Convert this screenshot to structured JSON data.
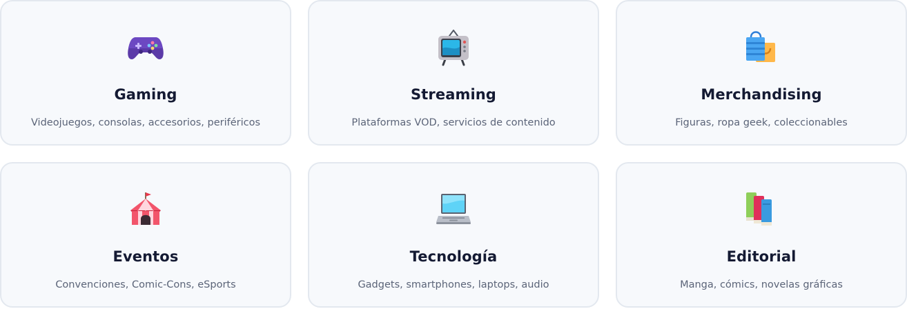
{
  "cards": [
    {
      "icon": "game-controller-icon",
      "title": "Gaming",
      "description": "Videojuegos, consolas, accesorios, periféricos"
    },
    {
      "icon": "television-icon",
      "title": "Streaming",
      "description": "Plataformas VOD, servicios de contenido"
    },
    {
      "icon": "shopping-bags-icon",
      "title": "Merchandising",
      "description": "Figuras, ropa geek, coleccionables"
    },
    {
      "icon": "circus-tent-icon",
      "title": "Eventos",
      "description": "Convenciones, Comic-Cons, eSports"
    },
    {
      "icon": "laptop-icon",
      "title": "Tecnología",
      "description": "Gadgets, smartphones, laptops, audio"
    },
    {
      "icon": "books-icon",
      "title": "Editorial",
      "description": "Manga, cómics, novelas gráficas"
    }
  ],
  "colors": {
    "card_background": "#f7f9fc",
    "card_border": "#e3e8ef",
    "title": "#141a33",
    "description": "#5b6478"
  }
}
